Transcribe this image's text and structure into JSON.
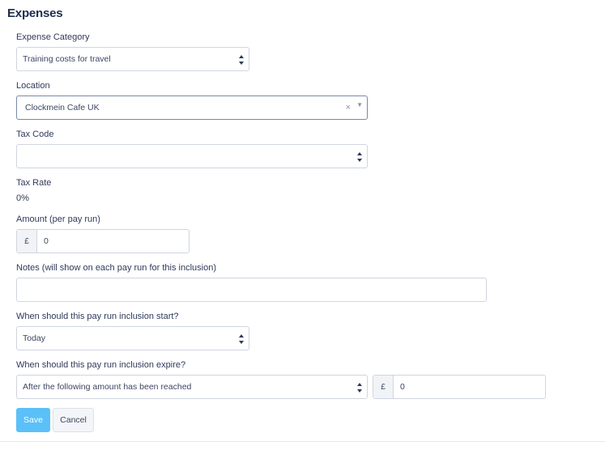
{
  "page": {
    "title": "Expenses"
  },
  "form": {
    "expense_category": {
      "label": "Expense Category",
      "value": "Training costs for travel"
    },
    "location": {
      "label": "Location",
      "value": "Clockmein Cafe UK",
      "clear_glyph": "×",
      "caret_glyph": "▼"
    },
    "tax_code": {
      "label": "Tax Code",
      "value": ""
    },
    "tax_rate": {
      "label": "Tax Rate",
      "value": "0%"
    },
    "amount": {
      "label": "Amount (per pay run)",
      "currency": "£",
      "value": "0"
    },
    "notes": {
      "label": "Notes (will show on each pay run for this inclusion)",
      "value": ""
    },
    "start": {
      "label": "When should this pay run inclusion start?",
      "value": "Today"
    },
    "expire": {
      "label": "When should this pay run inclusion expire?",
      "value": "After the following amount has been reached",
      "currency": "£",
      "amount": "0"
    }
  },
  "actions": {
    "save": "Save",
    "cancel": "Cancel"
  },
  "colors": {
    "primary": "#5bc0f8",
    "text": "#2e3a59",
    "border": "#cfd5e0"
  }
}
